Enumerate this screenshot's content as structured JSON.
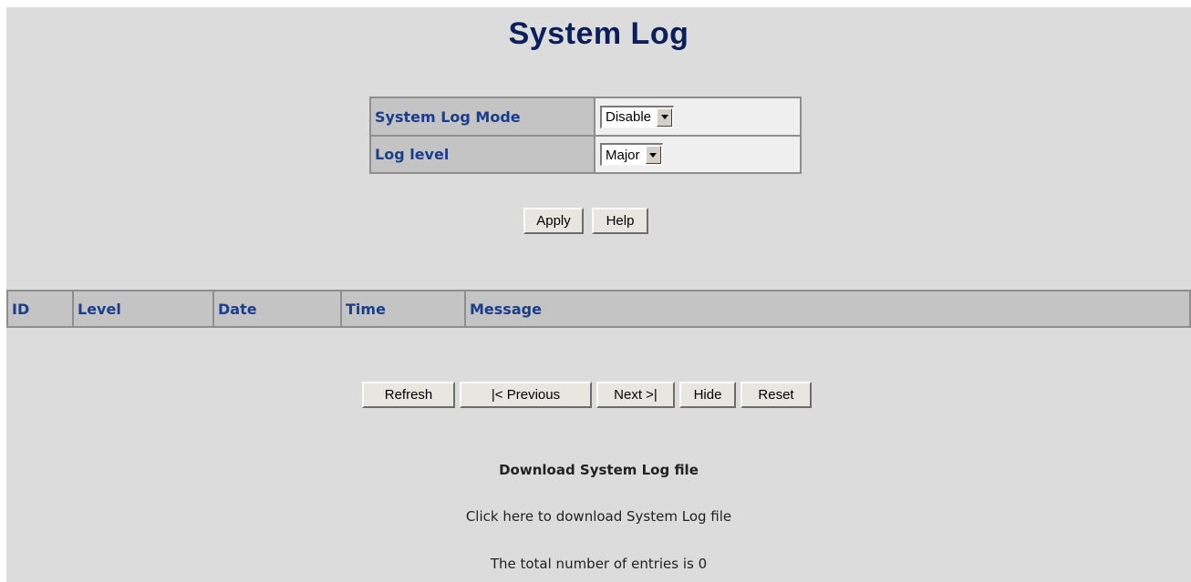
{
  "page": {
    "title": "System Log"
  },
  "settings": {
    "mode_label": "System Log Mode",
    "mode_value": "Disable",
    "level_label": "Log level",
    "level_value": "Major"
  },
  "buttons": {
    "apply": "Apply",
    "help": "Help",
    "refresh": "Refresh",
    "previous": "|< Previous",
    "next": "Next >|",
    "hide": "Hide",
    "reset": "Reset"
  },
  "log_table": {
    "columns": [
      "ID",
      "Level",
      "Date",
      "Time",
      "Message"
    ],
    "rows": []
  },
  "download": {
    "heading": "Download System Log file",
    "link_text": "Click here to download System Log file"
  },
  "summary": {
    "total_entries_text": "The total number of entries is 0"
  }
}
